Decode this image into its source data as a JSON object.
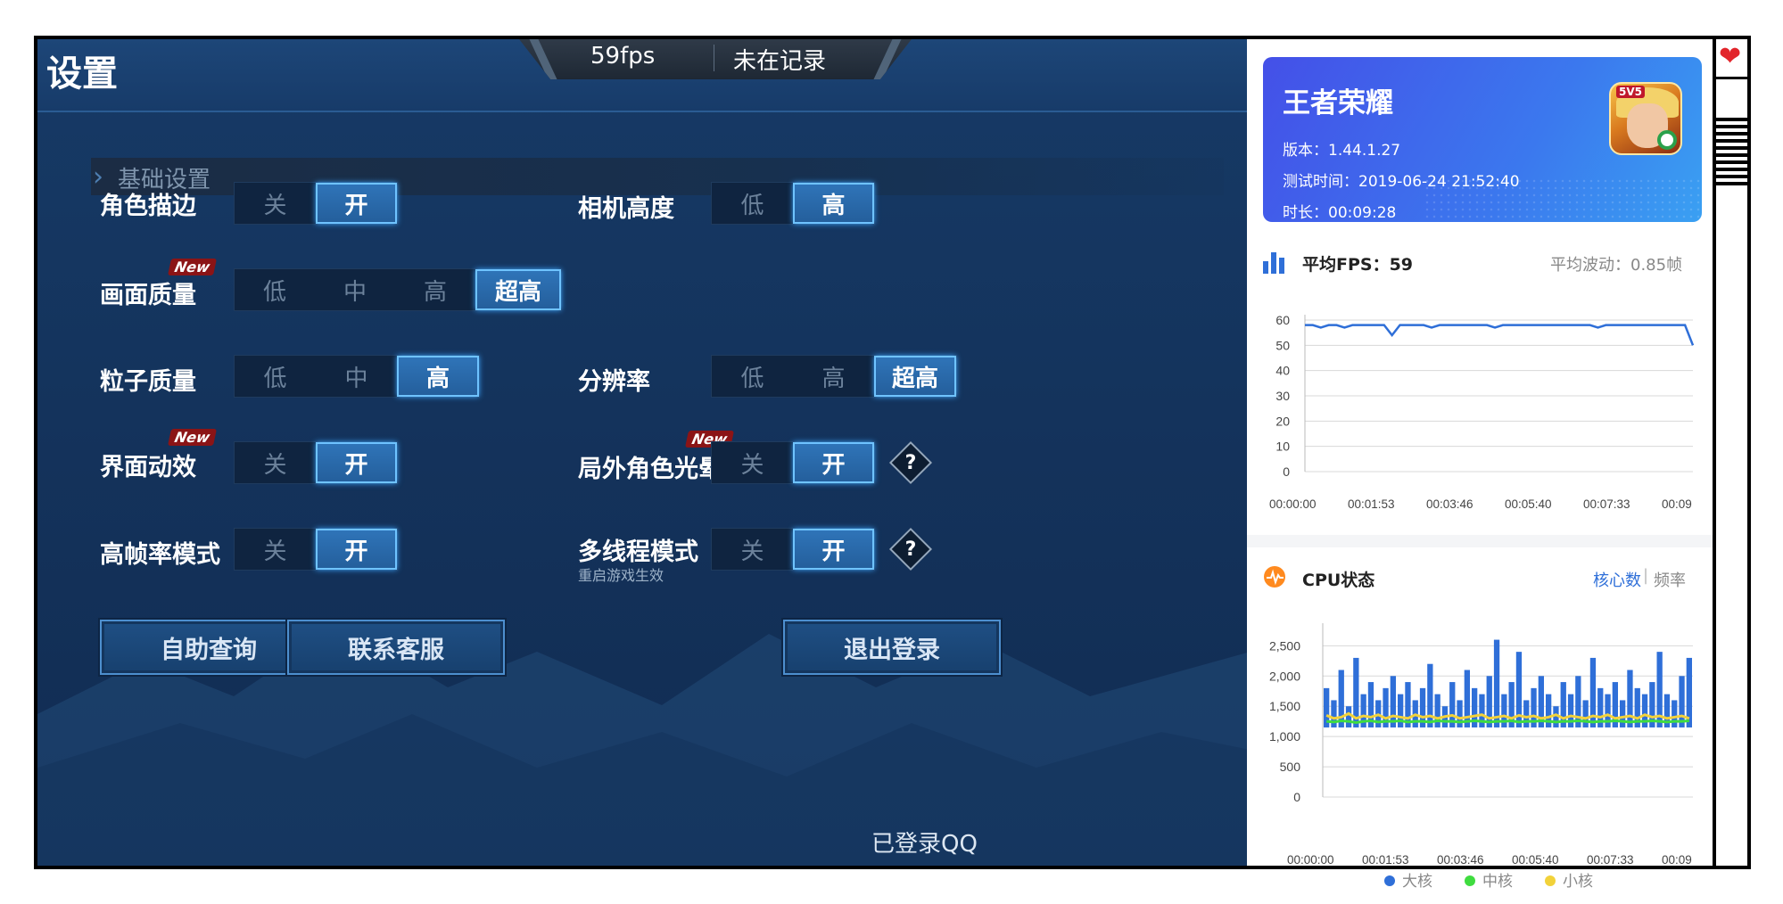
{
  "game_ui": {
    "title": "设置",
    "fps": "59fps",
    "record_status": "未在记录",
    "section": "基础设置",
    "new_tag": "New",
    "settings": {
      "outline": {
        "label": "角色描边",
        "options": [
          "关",
          "开"
        ]
      },
      "camera": {
        "label": "相机高度",
        "options": [
          "低",
          "高"
        ]
      },
      "quality": {
        "label": "画面质量",
        "options": [
          "低",
          "中",
          "高",
          "超高"
        ]
      },
      "particle": {
        "label": "粒子质量",
        "options": [
          "低",
          "中",
          "高"
        ]
      },
      "resolution": {
        "label": "分辨率",
        "options": [
          "低",
          "高",
          "超高"
        ]
      },
      "ui_effects": {
        "label": "界面动效",
        "options": [
          "关",
          "开"
        ]
      },
      "halo": {
        "label": "局外角色光晕",
        "options": [
          "关",
          "开"
        ]
      },
      "high_fps": {
        "label": "高帧率模式",
        "options": [
          "关",
          "开"
        ]
      },
      "multithread": {
        "label": "多线程模式",
        "sublabel": "重启游戏生效",
        "options": [
          "关",
          "开"
        ]
      }
    },
    "help_icon": "?",
    "buttons": {
      "self_help": "自助查询",
      "contact": "联系客服",
      "logout": "退出登录"
    },
    "qq_status": "已登录QQ"
  },
  "perf": {
    "game_name": "王者荣耀",
    "version": "版本：1.44.1.27",
    "test_time": "测试时间：2019-06-24 21:52:40",
    "duration": "时长：00:09:28",
    "icon_tag": "5V5",
    "fps_title": "平均FPS：59",
    "fps_fluct": "平均波动：0.85帧",
    "cpu_title": "CPU状态",
    "cpu_tab_cores": "核心数",
    "cpu_tab_freq": "频率",
    "cpu_legend": [
      "大核",
      "中核",
      "小核"
    ],
    "colors": {
      "accent": "#2f6fd8",
      "big": "#2f6fd8",
      "mid": "#3fdc3f",
      "small": "#f2d23a",
      "warn": "#ff8a1f"
    }
  },
  "chart_data": [
    {
      "type": "line",
      "title": "",
      "y_ticks": [
        0,
        10,
        20,
        30,
        40,
        50,
        60
      ],
      "ylim": [
        0,
        60
      ],
      "x_ticks": [
        "00:00:00",
        "00:01:53",
        "00:03:46",
        "00:05:40",
        "00:07:33",
        "00:09"
      ],
      "series": [
        {
          "values": [
            58,
            58,
            57,
            58,
            58,
            57,
            58,
            58,
            58,
            58,
            58,
            54,
            58,
            58,
            58,
            58,
            57,
            58,
            58,
            58,
            58,
            58,
            58,
            58,
            57,
            58,
            58,
            58,
            58,
            58,
            58,
            58,
            58,
            58,
            58,
            58,
            58,
            57,
            58,
            58,
            58,
            58,
            58,
            58,
            58,
            58,
            58,
            58,
            58,
            50
          ]
        }
      ]
    },
    {
      "type": "bar",
      "title": "",
      "y_ticks": [
        "0",
        "500",
        "1,000",
        "1,500",
        "2,000",
        "2,500"
      ],
      "ylim": [
        0,
        2800
      ],
      "x_ticks": [
        "00:00:00",
        "00:01:53",
        "00:03:46",
        "00:05:40",
        "00:07:33",
        "00:09"
      ],
      "series": [
        {
          "name": "大核",
          "values": [
            1800,
            1600,
            2100,
            1500,
            2300,
            1700,
            1900,
            1600,
            1800,
            2000,
            1700,
            1900,
            1600,
            1800,
            2200,
            1700,
            1500,
            1900,
            1600,
            2100,
            1800,
            1700,
            2000,
            2600,
            1700,
            1900,
            2400,
            1600,
            1800,
            2000,
            1700,
            1500,
            1900,
            1700,
            2000,
            1600,
            2300,
            1800,
            1700,
            1900,
            1600,
            2100,
            1800,
            1700,
            1900,
            2400,
            1700,
            1600,
            2000,
            2300
          ]
        },
        {
          "name": "中核",
          "values": [
            1250,
            1240,
            1260,
            1250,
            1230,
            1250,
            1260,
            1240,
            1250,
            1250,
            1260,
            1240,
            1250,
            1250,
            1240,
            1260,
            1250,
            1250,
            1240,
            1250,
            1260,
            1250,
            1240,
            1250,
            1250,
            1260,
            1240,
            1250,
            1250,
            1260,
            1250,
            1240,
            1250,
            1250,
            1260,
            1250,
            1240,
            1250,
            1250,
            1260,
            1250,
            1240,
            1250,
            1250,
            1260,
            1250,
            1240,
            1250,
            1250,
            1260
          ]
        },
        {
          "name": "小核",
          "values": [
            1350,
            1300,
            1320,
            1380,
            1300,
            1340,
            1320,
            1360,
            1300,
            1340,
            1320,
            1300,
            1360,
            1320,
            1340,
            1300,
            1330,
            1350,
            1300,
            1320,
            1340,
            1360,
            1300,
            1320,
            1340,
            1300,
            1350,
            1320,
            1340,
            1300,
            1320,
            1360,
            1300,
            1340,
            1320,
            1300,
            1340,
            1320,
            1360,
            1300,
            1320,
            1340,
            1300,
            1360,
            1320,
            1340,
            1300,
            1320,
            1340,
            1300
          ]
        }
      ]
    }
  ]
}
